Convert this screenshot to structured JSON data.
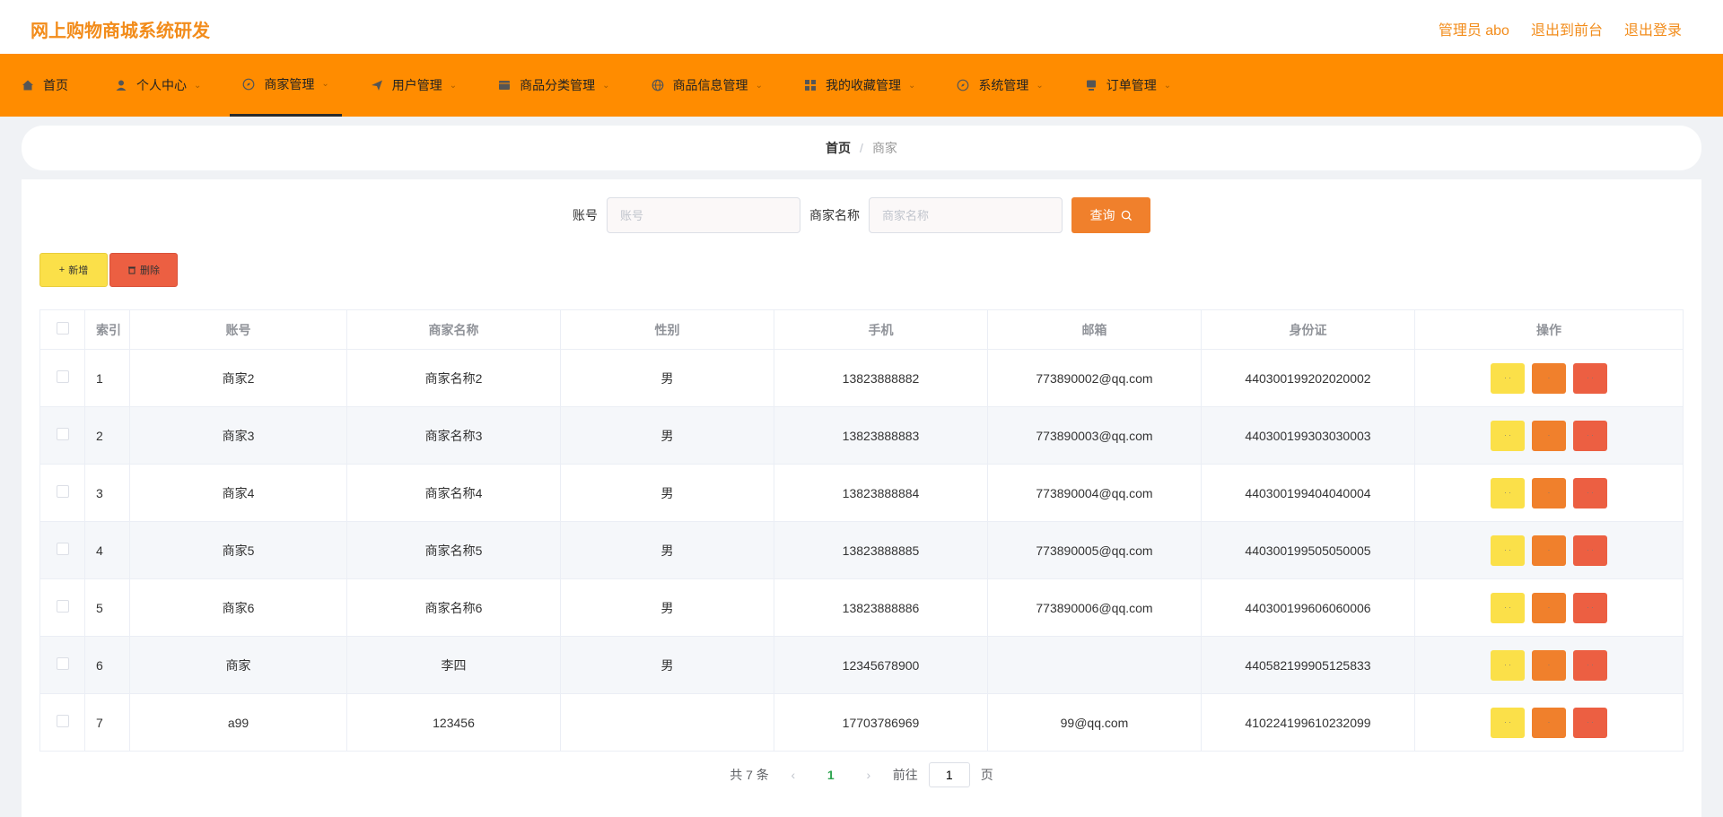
{
  "header": {
    "title": "网上购物商城系统研发",
    "links": [
      "管理员 abo",
      "退出到前台",
      "退出登录"
    ]
  },
  "nav": [
    {
      "label": "首页",
      "icon": "home-icon",
      "chevron": false
    },
    {
      "label": "个人中心",
      "icon": "user-icon",
      "chevron": true
    },
    {
      "label": "商家管理",
      "icon": "compass-icon",
      "chevron": true,
      "active": true
    },
    {
      "label": "用户管理",
      "icon": "send-icon",
      "chevron": true
    },
    {
      "label": "商品分类管理",
      "icon": "folder-icon",
      "chevron": true
    },
    {
      "label": "商品信息管理",
      "icon": "globe-icon",
      "chevron": true
    },
    {
      "label": "我的收藏管理",
      "icon": "grid-icon",
      "chevron": true
    },
    {
      "label": "系统管理",
      "icon": "compass-icon",
      "chevron": true
    },
    {
      "label": "订单管理",
      "icon": "cart-icon",
      "chevron": true
    }
  ],
  "breadcrumb": {
    "home": "首页",
    "separator": "/",
    "current": "商家"
  },
  "search": {
    "account_label": "账号",
    "account_placeholder": "账号",
    "name_label": "商家名称",
    "name_placeholder": "商家名称",
    "query_label": "查询"
  },
  "actions": {
    "add_label": "新增",
    "delete_label": "删除"
  },
  "table": {
    "headers": [
      "索引",
      "账号",
      "商家名称",
      "性别",
      "手机",
      "邮箱",
      "身份证",
      "操作"
    ],
    "rows": [
      {
        "index": "1",
        "account": "商家2",
        "name": "商家名称2",
        "gender": "男",
        "phone": "13823888882",
        "email": "773890002@qq.com",
        "id_card": "440300199202020002"
      },
      {
        "index": "2",
        "account": "商家3",
        "name": "商家名称3",
        "gender": "男",
        "phone": "13823888883",
        "email": "773890003@qq.com",
        "id_card": "440300199303030003"
      },
      {
        "index": "3",
        "account": "商家4",
        "name": "商家名称4",
        "gender": "男",
        "phone": "13823888884",
        "email": "773890004@qq.com",
        "id_card": "440300199404040004"
      },
      {
        "index": "4",
        "account": "商家5",
        "name": "商家名称5",
        "gender": "男",
        "phone": "13823888885",
        "email": "773890005@qq.com",
        "id_card": "440300199505050005"
      },
      {
        "index": "5",
        "account": "商家6",
        "name": "商家名称6",
        "gender": "男",
        "phone": "13823888886",
        "email": "773890006@qq.com",
        "id_card": "440300199606060006"
      },
      {
        "index": "6",
        "account": "商家",
        "name": "李四",
        "gender": "男",
        "phone": "12345678900",
        "email": "",
        "id_card": "440582199905125833"
      },
      {
        "index": "7",
        "account": "a99",
        "name": "123456",
        "gender": "",
        "phone": "17703786969",
        "email": "99@qq.com",
        "id_card": "410224199610232099"
      }
    ]
  },
  "pagination": {
    "total_text": "共 7 条",
    "current_page": "1",
    "goto_label": "前往",
    "goto_value": "1",
    "page_suffix": "页"
  },
  "colors": {
    "accent": "#ff8c00",
    "title": "#f28c1b",
    "yellow": "#fbe049",
    "orange": "#f0802c",
    "red": "#ec5f42"
  }
}
